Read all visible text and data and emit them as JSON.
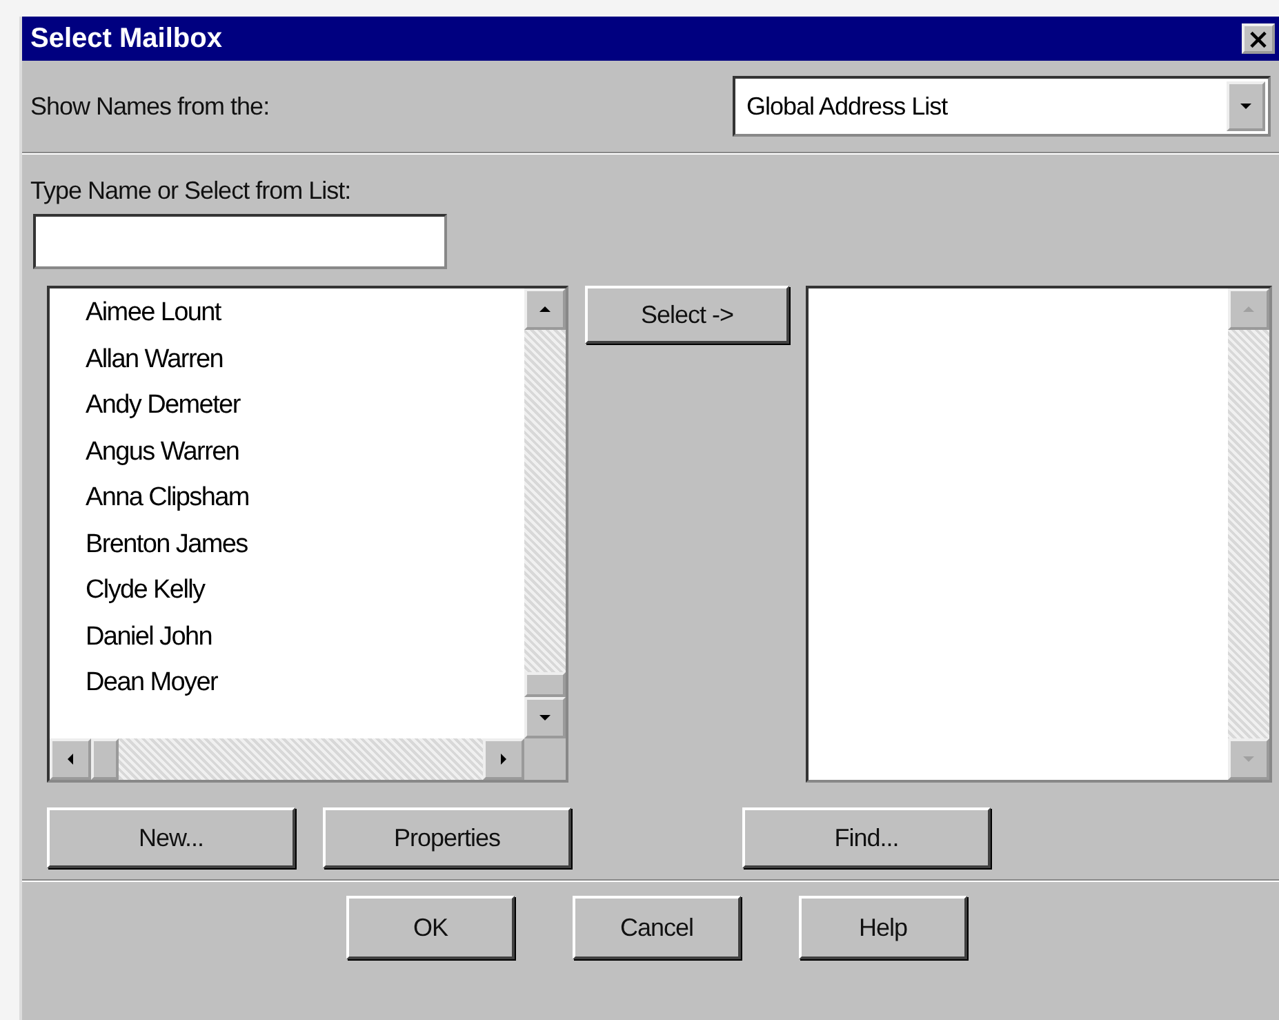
{
  "window": {
    "title": "Select Mailbox",
    "close": "×"
  },
  "show_names": {
    "label": "Show Names from the:",
    "dropdown": {
      "value": "Global Address List"
    }
  },
  "name_field": {
    "label": "Type Name or Select from List:"
  },
  "names": [
    {
      "name": "Aimee Lount"
    },
    {
      "name": "Allan  Warren"
    },
    {
      "name": "Andy Demeter"
    },
    {
      "name": "Angus Warren"
    },
    {
      "name": "Anna Clipsham"
    },
    {
      "name": "Brenton James"
    },
    {
      "name": "Clyde  Kelly"
    },
    {
      "name": "Daniel John"
    },
    {
      "name": "Dean Moyer"
    }
  ],
  "select_button": {
    "label": "Select ->"
  },
  "list_buttons": [
    {
      "label": "New..."
    },
    {
      "label": "Properties"
    }
  ],
  "find_button": {
    "label": "Find..."
  },
  "dialog_buttons": [
    {
      "label": "OK"
    },
    {
      "label": "Cancel"
    },
    {
      "label": "Help"
    }
  ]
}
